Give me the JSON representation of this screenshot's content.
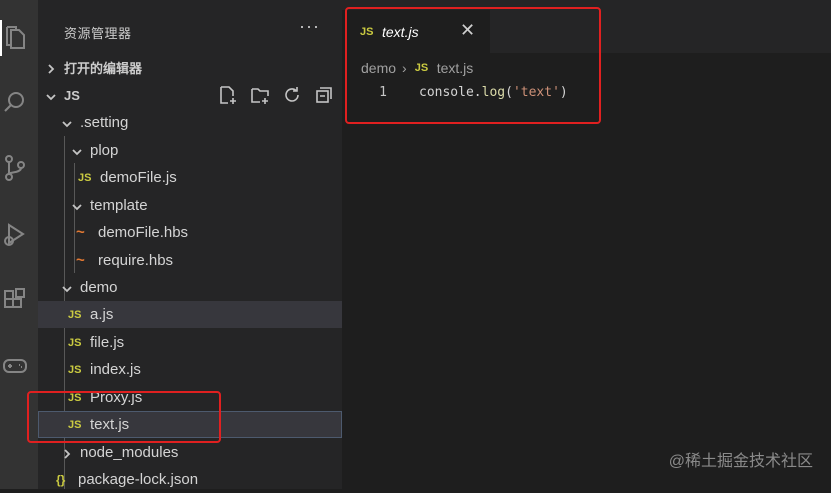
{
  "sidebar": {
    "title": "资源管理器",
    "more": "···",
    "open_editors": "打开的编辑器",
    "root": "JS",
    "tree": [
      {
        "label": ".setting",
        "kind": "folder"
      },
      {
        "label": "plop",
        "kind": "folder"
      },
      {
        "label": "demoFile.js",
        "kind": "js"
      },
      {
        "label": "template",
        "kind": "folder"
      },
      {
        "label": "demoFile.hbs",
        "kind": "hbs"
      },
      {
        "label": "require.hbs",
        "kind": "hbs"
      },
      {
        "label": "demo",
        "kind": "folder"
      },
      {
        "label": "a.js",
        "kind": "js"
      },
      {
        "label": "file.js",
        "kind": "js"
      },
      {
        "label": "index.js",
        "kind": "js"
      },
      {
        "label": "Proxy.js",
        "kind": "js"
      },
      {
        "label": "text.js",
        "kind": "js"
      },
      {
        "label": "node_modules",
        "kind": "folder"
      },
      {
        "label": "package-lock.json",
        "kind": "json"
      }
    ],
    "badges": {
      "js": "JS",
      "hbs": "~",
      "json": "{}"
    }
  },
  "editor": {
    "tab_label": "text.js",
    "tab_close": "✕",
    "breadcrumb": [
      "demo",
      "text.js"
    ],
    "line_number": "1",
    "code": {
      "obj": "console",
      "dot": ".",
      "fn": "log",
      "open": "(",
      "str": "'text'",
      "close": ")"
    }
  },
  "watermark": "@稀土掘金技术社区",
  "colors": {
    "highlight": "#e02020",
    "js_badge": "#cbcb41",
    "hbs_badge": "#e37933"
  },
  "activity_icons": [
    "files-icon",
    "search-icon",
    "source-control-icon",
    "run-debug-icon",
    "extensions-icon",
    "remote-icon"
  ]
}
